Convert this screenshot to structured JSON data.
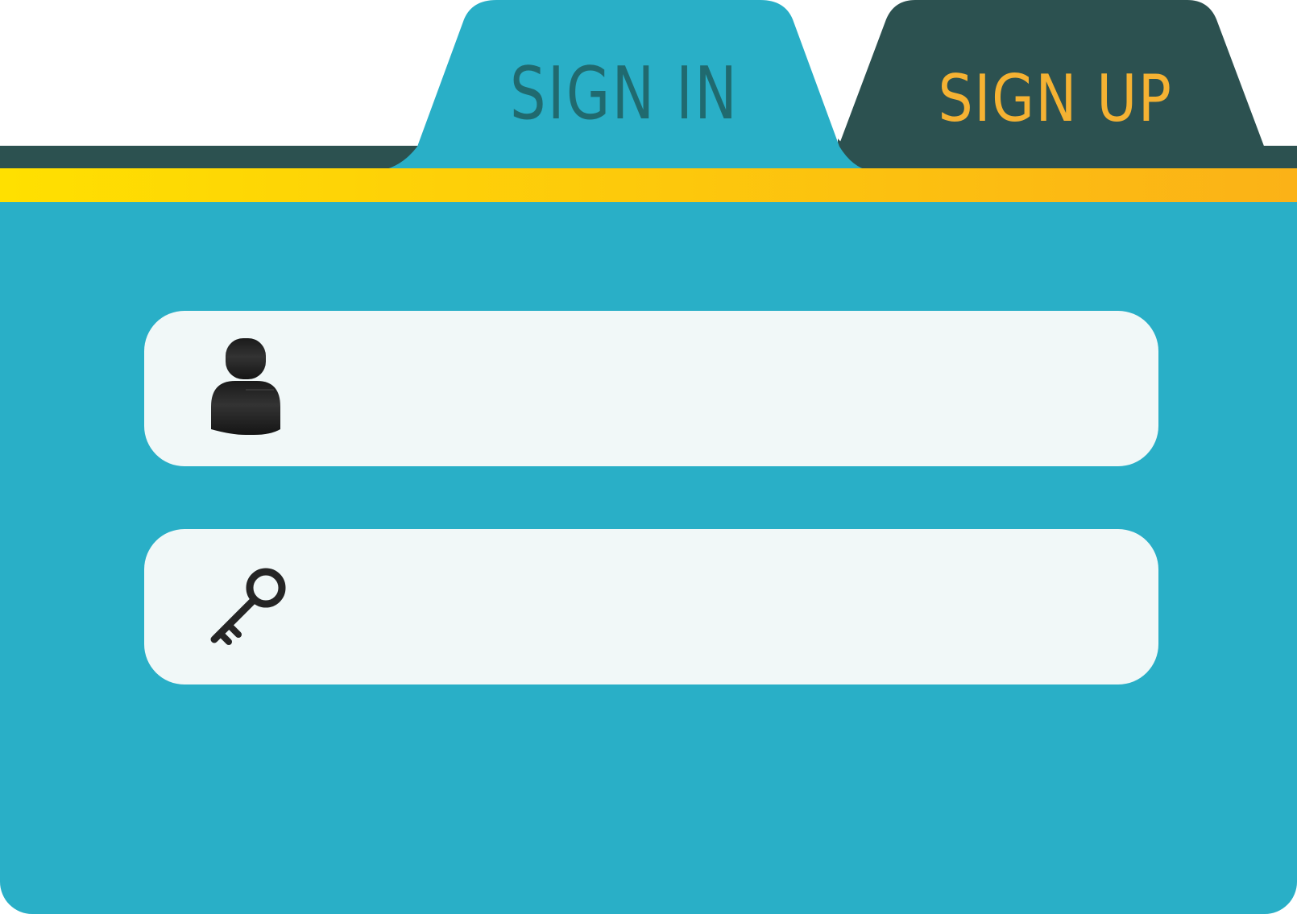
{
  "tabs": {
    "signin": {
      "label": "SIGN IN",
      "active": true
    },
    "signup": {
      "label": "SIGN UP",
      "active": false
    }
  },
  "form": {
    "username": {
      "icon": "user-icon",
      "value": "",
      "placeholder": ""
    },
    "password": {
      "icon": "key-icon",
      "value": "",
      "placeholder": ""
    }
  },
  "colors": {
    "panel": "#29AFC7",
    "active_tab": "#29AFC7",
    "inactive_tab": "#2C5150",
    "signin_text": "#206A6F",
    "signup_text": "#F5B233",
    "field_bg": "#F1F8F8",
    "icon": "#252525",
    "accent_start": "#FFE000",
    "accent_end": "#FBB217"
  }
}
